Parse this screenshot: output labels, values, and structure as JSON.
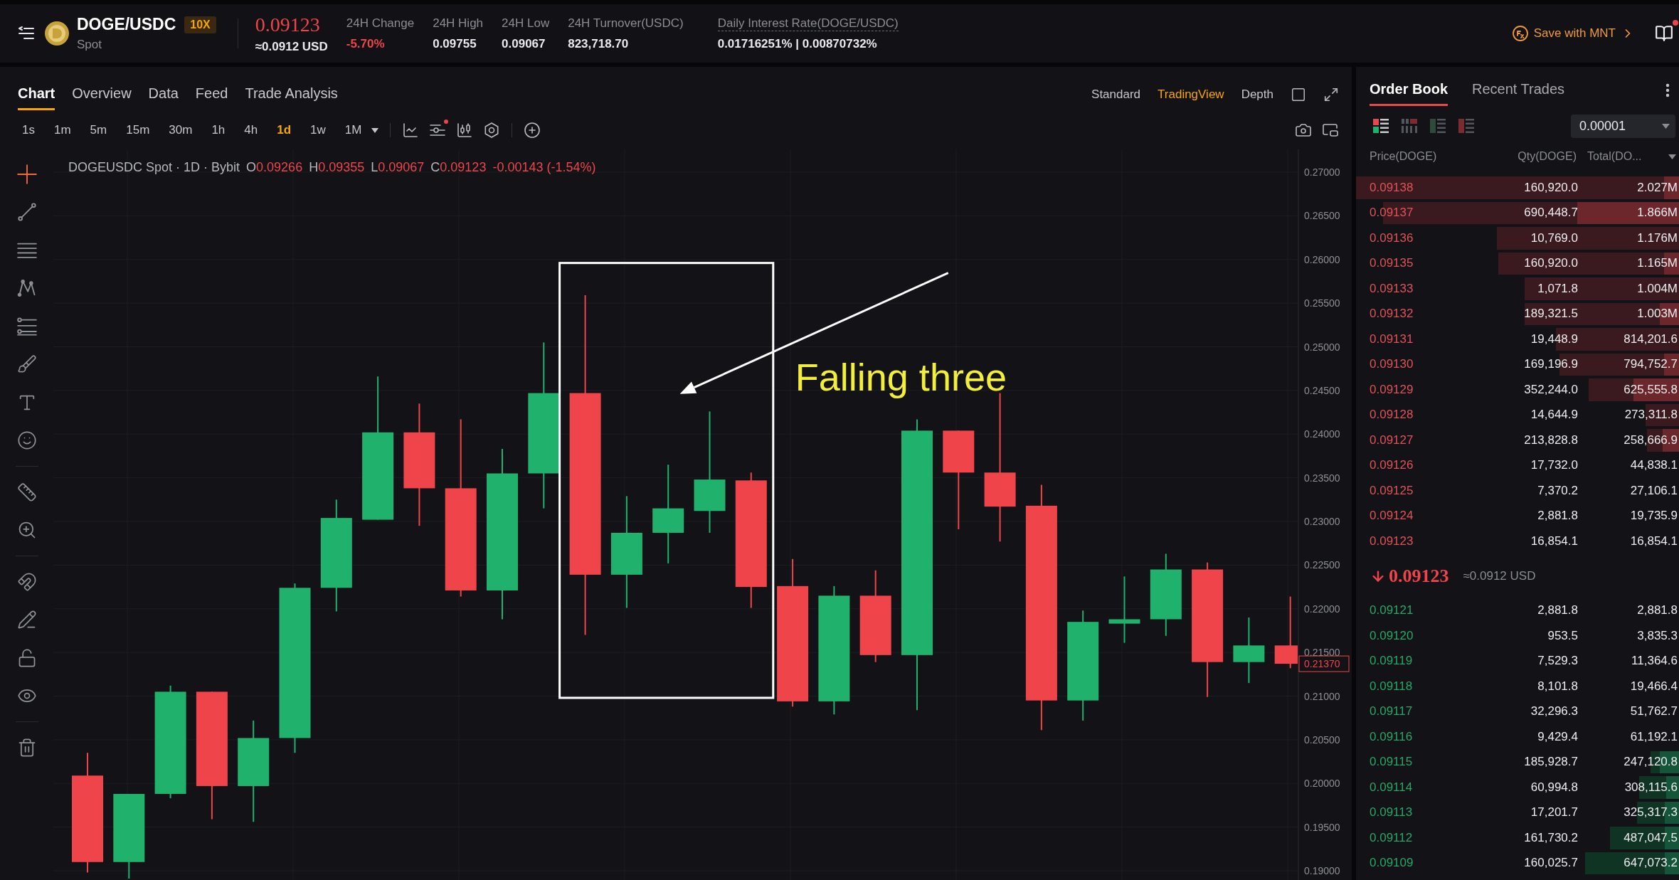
{
  "header": {
    "pair": "DOGE/USDC",
    "leverage": "10X",
    "market": "Spot",
    "price": "0.09123",
    "price_usd": "≈0.0912 USD",
    "stats": [
      {
        "kind": "change",
        "label": "24H Change",
        "value": "-5.70%"
      },
      {
        "kind": "plain",
        "label": "24H High",
        "value": "0.09755"
      },
      {
        "kind": "plain",
        "label": "24H Low",
        "value": "0.09067"
      },
      {
        "kind": "plain",
        "label": "24H Turnover(USDC)",
        "value": "823,718.70"
      },
      {
        "kind": "dotted",
        "label": "Daily Interest Rate(DOGE/USDC)",
        "value": "0.01716251% | 0.00870732%"
      }
    ],
    "promo": "Save with MNT",
    "docs_unread": true
  },
  "chart_panel": {
    "tabs": [
      {
        "label": "Chart",
        "selected": true
      },
      {
        "label": "Overview",
        "selected": false
      },
      {
        "label": "Data",
        "selected": false
      },
      {
        "label": "Feed",
        "selected": false
      },
      {
        "label": "Trade Analysis",
        "selected": false
      }
    ],
    "views": [
      {
        "label": "Standard",
        "selected": false
      },
      {
        "label": "TradingView",
        "selected": true
      },
      {
        "label": "Depth",
        "selected": false
      }
    ],
    "intervals": [
      {
        "label": "1s",
        "selected": false
      },
      {
        "label": "1m",
        "selected": false
      },
      {
        "label": "5m",
        "selected": false
      },
      {
        "label": "15m",
        "selected": false
      },
      {
        "label": "30m",
        "selected": false
      },
      {
        "label": "1h",
        "selected": false
      },
      {
        "label": "4h",
        "selected": false
      },
      {
        "label": "1d",
        "selected": true
      },
      {
        "label": "1w",
        "selected": false
      },
      {
        "label": "1M",
        "selected": false
      }
    ],
    "indicator_alert": true,
    "tool_groups": [
      {
        "tools": [
          {
            "kind": "crosshair",
            "selected": true
          },
          {
            "kind": "trend-line",
            "selected": false
          },
          {
            "kind": "horizontal-lines",
            "selected": false
          },
          {
            "kind": "pattern",
            "selected": false
          },
          {
            "kind": "fib",
            "selected": false
          },
          {
            "kind": "brush",
            "selected": false
          },
          {
            "kind": "text",
            "selected": false
          },
          {
            "kind": "emoji",
            "selected": false
          }
        ]
      },
      {
        "tools": [
          {
            "kind": "ruler",
            "selected": false
          },
          {
            "kind": "zoom",
            "selected": false
          }
        ]
      },
      {
        "tools": [
          {
            "kind": "magnet",
            "selected": false
          },
          {
            "kind": "draw-lock",
            "selected": false
          },
          {
            "kind": "lock",
            "selected": false
          },
          {
            "kind": "eye",
            "selected": false
          }
        ]
      },
      {
        "tools": [
          {
            "kind": "trash",
            "selected": false
          }
        ]
      }
    ],
    "legend": {
      "symbol": "DOGEUSDC Spot · 1D · Bybit",
      "ohlc": [
        {
          "key": "O",
          "value": "0.09266"
        },
        {
          "key": "H",
          "value": "0.09355"
        },
        {
          "key": "L",
          "value": "0.09067"
        },
        {
          "key": "C",
          "value": "0.09123"
        }
      ],
      "change": "-0.00143 (-1.54%)"
    },
    "price_axis": [
      "0.27000",
      "0.26500",
      "0.26000",
      "0.25500",
      "0.25000",
      "0.24500",
      "0.24000",
      "0.23500",
      "0.23000",
      "0.22500",
      "0.22000",
      "0.21500",
      "0.21000",
      "0.20500",
      "0.20000",
      "0.19500",
      "0.19000"
    ],
    "last_price_label": "0.21370",
    "annotation": {
      "label": "Falling three"
    }
  },
  "order_book": {
    "tabs": [
      {
        "label": "Order Book",
        "selected": true
      },
      {
        "label": "Recent Trades",
        "selected": false
      }
    ],
    "layouts": [
      {
        "kind": "both",
        "selected": true
      },
      {
        "kind": "columns",
        "selected": false
      },
      {
        "kind": "bids",
        "selected": false
      },
      {
        "kind": "asks",
        "selected": false
      }
    ],
    "tick_size": "0.00001",
    "columns": [
      "Price(DOGE)",
      "Qty(DOGE)",
      "Total(DO..."
    ],
    "asks": [
      {
        "price": "0.09138",
        "qty": "160,920.0",
        "total": "2.027M",
        "depth": {
          "level": 1.0
        },
        "volume": {
          "level": 0.046
        }
      },
      {
        "price": "0.09137",
        "qty": "690,448.7",
        "total": "1.866M",
        "depth": {
          "level": 0.917
        },
        "volume": {
          "level": 0.316
        }
      },
      {
        "price": "0.09136",
        "qty": "10,769.0",
        "total": "1.176M",
        "depth": {
          "level": 0.564
        }
      },
      {
        "price": "0.09135",
        "qty": "160,920.0",
        "total": "1.165M",
        "depth": {
          "level": 0.56
        },
        "volume": {
          "level": 0.046
        }
      },
      {
        "price": "0.09133",
        "qty": "1,071.8",
        "total": "1.004M",
        "depth": {
          "level": 0.477
        }
      },
      {
        "price": "0.09132",
        "qty": "189,321.5",
        "total": "1.003M",
        "depth": {
          "level": 0.477
        },
        "volume": {
          "level": 0.06
        }
      },
      {
        "price": "0.09131",
        "qty": "19,448.9",
        "total": "814,201.6",
        "depth": {
          "level": 0.38
        }
      },
      {
        "price": "0.09130",
        "qty": "169,196.9",
        "total": "794,752.7",
        "depth": {
          "level": 0.37
        },
        "volume": {
          "level": 0.046
        }
      },
      {
        "price": "0.09129",
        "qty": "352,244.0",
        "total": "625,555.8",
        "depth": {
          "level": 0.28
        },
        "volume": {
          "level": 0.14
        }
      },
      {
        "price": "0.09128",
        "qty": "14,644.9",
        "total": "273,311.8",
        "depth": {
          "level": 0.103
        }
      },
      {
        "price": "0.09127",
        "qty": "213,828.8",
        "total": "258,666.9",
        "depth": {
          "level": 0.1
        },
        "volume": {
          "level": 0.05
        }
      },
      {
        "price": "0.09126",
        "qty": "17,732.0",
        "total": "44,838.1"
      },
      {
        "price": "0.09125",
        "qty": "7,370.2",
        "total": "27,106.1"
      },
      {
        "price": "0.09124",
        "qty": "2,881.8",
        "total": "19,735.9"
      },
      {
        "price": "0.09123",
        "qty": "16,854.1",
        "total": "16,854.1"
      }
    ],
    "last_price": {
      "falling": true,
      "value": "0.09123",
      "usd": "≈0.0912 USD"
    },
    "bids": [
      {
        "price": "0.09121",
        "qty": "2,881.8",
        "total": "2,881.8"
      },
      {
        "price": "0.09120",
        "qty": "953.5",
        "total": "3,835.3"
      },
      {
        "price": "0.09119",
        "qty": "7,529.3",
        "total": "11,364.6"
      },
      {
        "price": "0.09118",
        "qty": "8,101.8",
        "total": "19,466.4"
      },
      {
        "price": "0.09117",
        "qty": "32,296.3",
        "total": "51,762.7"
      },
      {
        "price": "0.09116",
        "qty": "9,429.4",
        "total": "61,192.1"
      },
      {
        "price": "0.09115",
        "qty": "185,928.7",
        "total": "247,120.8",
        "depth": {
          "level": 0.089
        },
        "volume": {
          "level": 0.059
        }
      },
      {
        "price": "0.09114",
        "qty": "60,994.8",
        "total": "308,115.6",
        "depth": {
          "level": 0.123
        },
        "volume": {
          "level": 0.04
        }
      },
      {
        "price": "0.09113",
        "qty": "17,201.7",
        "total": "325,317.3",
        "depth": {
          "level": 0.13
        },
        "volume": {
          "level": 0.044
        }
      },
      {
        "price": "0.09112",
        "qty": "161,730.2",
        "total": "487,047.5",
        "depth": {
          "level": 0.213
        },
        "volume": {
          "level": 0.044
        }
      },
      {
        "price": "0.09109",
        "qty": "160,025.7",
        "total": "647,073.2",
        "depth": {
          "level": 0.29
        },
        "volume": {
          "level": 0.044
        }
      }
    ]
  }
}
